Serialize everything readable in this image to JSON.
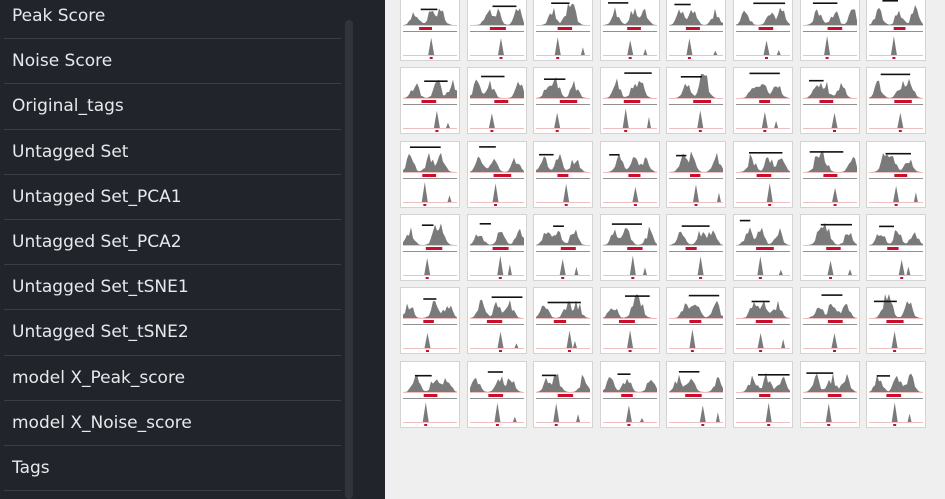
{
  "sidebar": {
    "items": [
      {
        "label": "Peak Score"
      },
      {
        "label": "Noise Score"
      },
      {
        "label": "Original_tags"
      },
      {
        "label": "Untagged Set"
      },
      {
        "label": "Untagged Set_PCA1"
      },
      {
        "label": "Untagged Set_PCA2"
      },
      {
        "label": "Untagged Set_tSNE1"
      },
      {
        "label": "Untagged Set_tSNE2"
      },
      {
        "label": "model X_Peak_score"
      },
      {
        "label": "model X_Noise_score"
      },
      {
        "label": "Tags"
      }
    ]
  },
  "gallery": {
    "rows": 6,
    "columns": 8,
    "thumbnail_icon": "peak-signal-plot-icon",
    "colors": {
      "fill": "#7a7a7a",
      "highlight": "#c8102e",
      "annotation_bar": "#111111",
      "baseline": "#e08080"
    }
  }
}
